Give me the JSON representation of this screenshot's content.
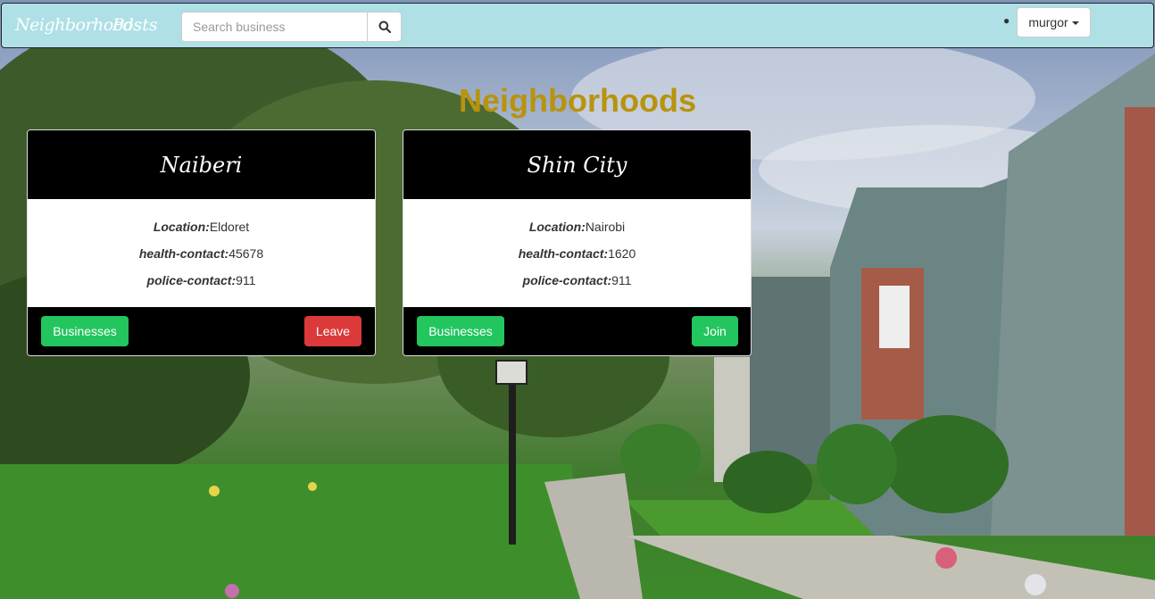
{
  "navbar": {
    "brand": "Neighborhoods",
    "posts_link": "Posts",
    "search_placeholder": "Search business",
    "search_icon": "search-icon",
    "user_menu_label": "murgor",
    "user_menu_icon": "caret-down-icon"
  },
  "page_title": "Neighborhoods",
  "colors": {
    "navbar_bg": "#aee0e6",
    "title_color": "#b8930c",
    "green_button": "#22c55e",
    "red_button": "#dc3a3a"
  },
  "neighborhoods": [
    {
      "name": "Naiberi",
      "location_label": "Location:",
      "location": "Eldoret",
      "health_label": "health-contact:",
      "health": "45678",
      "police_label": "police-contact:",
      "police": "911",
      "businesses_label": "Businesses",
      "action_label": "Leave"
    },
    {
      "name": "Shin City",
      "location_label": "Location:",
      "location": "Nairobi",
      "health_label": "health-contact:",
      "health": "1620",
      "police_label": "police-contact:",
      "police": "911",
      "businesses_label": "Businesses",
      "action_label": "Join"
    }
  ]
}
